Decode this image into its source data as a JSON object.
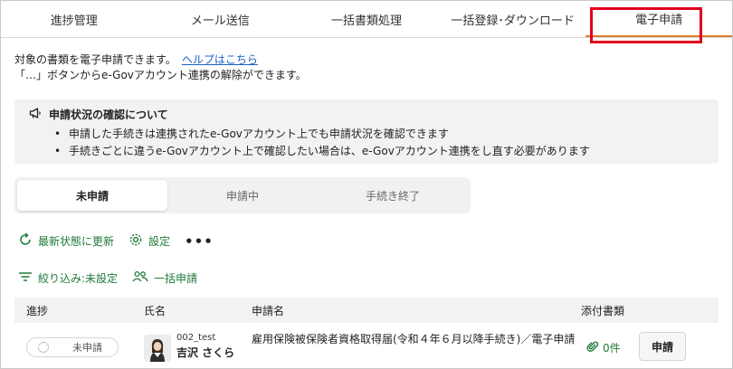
{
  "tabs": [
    {
      "label": "進捗管理"
    },
    {
      "label": "メール送信"
    },
    {
      "label": "一括書類処理"
    },
    {
      "label": "一括登録･ダウンロード"
    },
    {
      "label": "電子申請"
    }
  ],
  "intro": {
    "line1": "対象の書類を電子申請できます。",
    "help_link": "ヘルプはこちら",
    "line2": "「…」ボタンからe-Govアカウント連携の解除ができます。"
  },
  "notice": {
    "title": "申請状況の確認について",
    "items": [
      "申請した手続きは連携されたe-Govアカウント上でも申請状況を確認できます",
      "手続きごとに違うe-Govアカウント上で確認したい場合は、e-Govアカウント連携をし直す必要があります"
    ]
  },
  "segments": [
    {
      "label": "未申請"
    },
    {
      "label": "申請中"
    },
    {
      "label": "手続き終了"
    }
  ],
  "actions": {
    "refresh": "最新状態に更新",
    "settings": "設定",
    "more": "•••",
    "filter": "絞り込み:未設定",
    "bulk_apply": "一括申請"
  },
  "table": {
    "headers": {
      "progress": "進捗",
      "name": "氏名",
      "application": "申請名",
      "attachments": "添付書類"
    },
    "rows": [
      {
        "status": "未申請",
        "employee_id": "002_test",
        "employee_name": "吉沢 さくら",
        "application_name": "雇用保険被保険者資格取得届(令和４年６月以降手続き)／電子申請",
        "attachments": "0件",
        "action": "申請"
      }
    ]
  },
  "colors": {
    "accent_green": "#1f7a3a",
    "tab_underline": "#e07b2a",
    "highlight_red": "#e0001b",
    "link_blue": "#1a63c8"
  }
}
